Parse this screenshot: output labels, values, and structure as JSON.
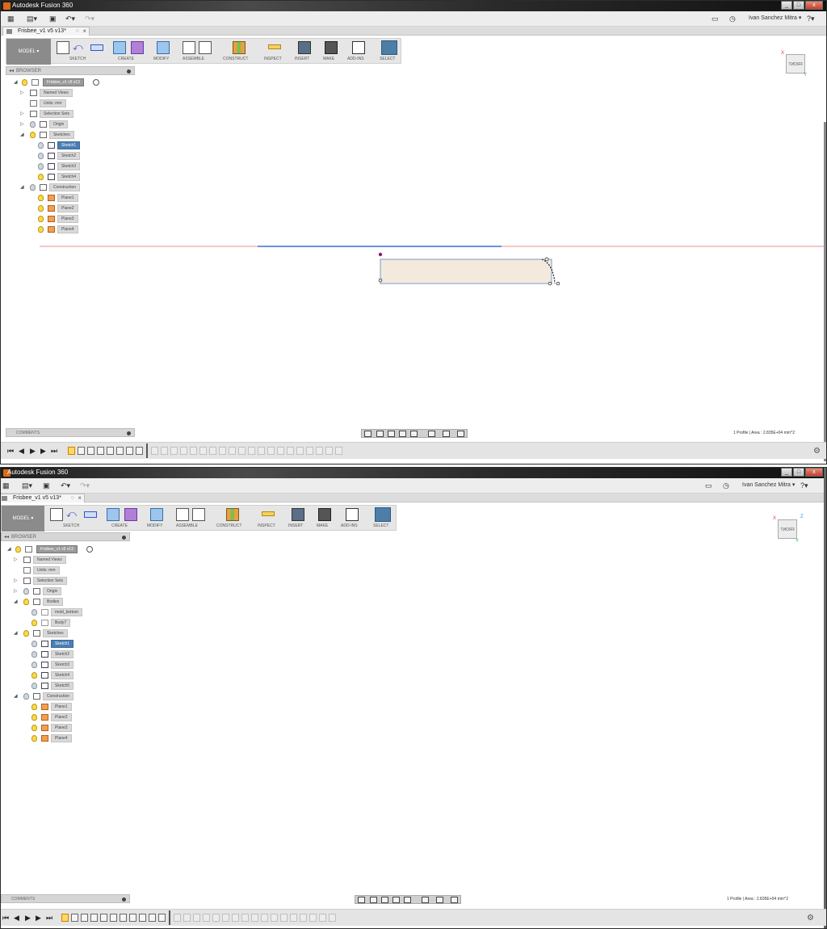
{
  "app": {
    "title": "Autodesk Fusion 360"
  },
  "user": "Ivan Sanchez Mitra",
  "document_tab": "Frisbee_v1 v5 v13*",
  "workspace": "MODEL",
  "ribbon_groups": [
    "SKETCH",
    "CREATE",
    "MODIFY",
    "ASSEMBLE",
    "CONSTRUCT",
    "INSPECT",
    "INSERT",
    "MAKE",
    "ADD-INS",
    "SELECT"
  ],
  "browser": {
    "header": "BROWSER",
    "root": "Frisbee_v1 v5 v13",
    "window1": {
      "items": [
        "Named Views",
        "Units: mm",
        "Selection Sets",
        "Origin",
        "Sketches",
        "Sketch1",
        "Sketch2",
        "Sketch3",
        "Sketch4",
        "Construction",
        "Plane1",
        "Plane2",
        "Plane3",
        "Plane4"
      ]
    },
    "window2": {
      "items": [
        "Named Views",
        "Units: mm",
        "Selection Sets",
        "Origin",
        "Bodies",
        "mold_bottom",
        "Body7",
        "Sketches",
        "Sketch1",
        "Sketch2",
        "Sketch3",
        "Sketch4",
        "Sketch5",
        "Construction",
        "Plane1",
        "Plane2",
        "Plane3",
        "Plane4"
      ]
    }
  },
  "comments": "COMMENTS",
  "status": "1 Profile | Area : 2.835E+04 mm^2",
  "viewcube_label": "FRONT",
  "axis": {
    "x": "X",
    "y": "Y",
    "z": "Z"
  },
  "icons": {
    "grid": "app-grid-icon",
    "file": "file-icon",
    "save": "save-icon",
    "undo": "undo-icon",
    "redo": "redo-icon",
    "chat": "job-status-icon",
    "clock": "clock-icon",
    "help": "help-icon",
    "settings": "gear-icon"
  },
  "colors": {
    "selection": "#4a7fb5",
    "sketch_fill": "#f3e9dd",
    "axis_red": "#e06a6a",
    "axis_blue": "#3a6fd1",
    "body_gray": "#7d7a73",
    "constraint_purple": "#8a1a6a"
  }
}
